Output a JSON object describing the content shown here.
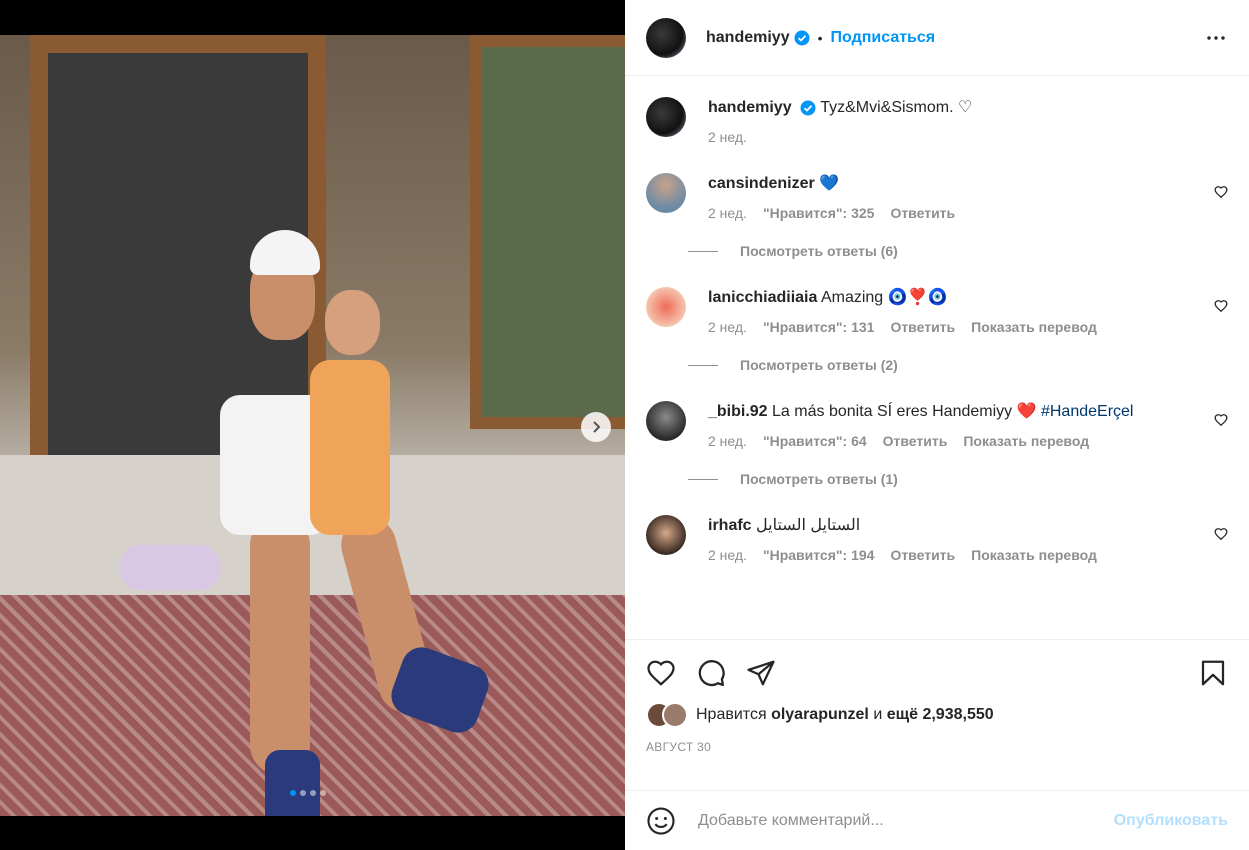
{
  "post": {
    "author": "handemiyy",
    "follow_label": "Подписаться",
    "dot_separator": "•",
    "caption_text": "Tyz&Mvi&Sismom. ♡",
    "caption_time": "2 нед."
  },
  "comments": [
    {
      "user": "cansindenizer",
      "text": "💙",
      "time": "2 нед.",
      "likes": "\"Нравится\": 325",
      "reply": "Ответить",
      "translate": "",
      "view_replies": "Посмотреть ответы (6)"
    },
    {
      "user": "lanicchiadiiaia",
      "text": "Amazing 🧿❣️🧿",
      "time": "2 нед.",
      "likes": "\"Нравится\": 131",
      "reply": "Ответить",
      "translate": "Показать перевод",
      "view_replies": "Посмотреть ответы (2)"
    },
    {
      "user": "_bibi.92",
      "text": "La más bonita SÍ eres Handemiyy ❤️",
      "hashtag": "#HandeErçel",
      "time": "2 нед.",
      "likes": "\"Нравится\": 64",
      "reply": "Ответить",
      "translate": "Показать перевод",
      "view_replies": "Посмотреть ответы (1)"
    },
    {
      "user": "irhafc",
      "text": "الستايل الستايل",
      "time": "2 нед.",
      "likes": "\"Нравится\": 194",
      "reply": "Ответить",
      "translate": "Показать перевод",
      "view_replies": ""
    }
  ],
  "likes_line": {
    "prefix": "Нравится",
    "user": "olyarapunzel",
    "conj": "и",
    "count": "ещё 2,938,550"
  },
  "post_date": "АВГУСТ 30",
  "composer": {
    "placeholder": "Добавьте комментарий...",
    "publish_label": "Опубликовать"
  },
  "carousel": {
    "index": 1,
    "total": 4
  },
  "colors": {
    "accent": "#0095f6",
    "muted": "#8e8e8e",
    "publish_disabled": "#b2dffc"
  },
  "icons": [
    "verified-badge-icon",
    "more-options-icon",
    "heart-icon",
    "comment-icon",
    "share-icon",
    "bookmark-icon",
    "emoji-icon",
    "chevron-right-icon"
  ]
}
